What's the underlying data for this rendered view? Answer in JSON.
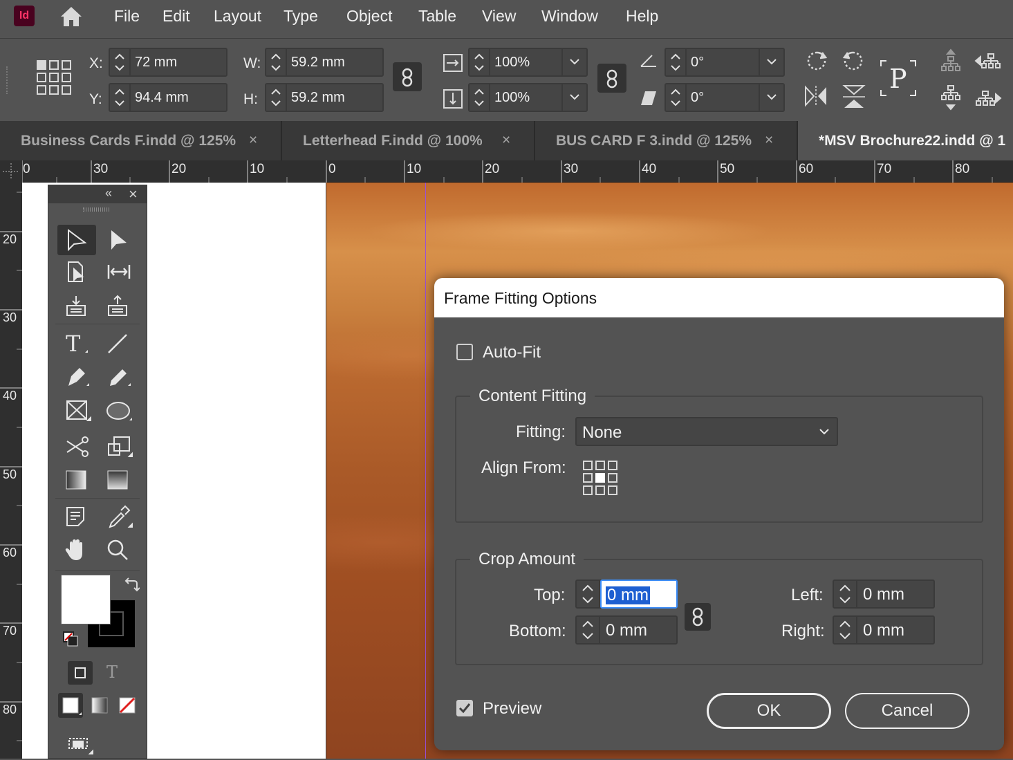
{
  "menu": {
    "app_logo": "Id",
    "items": [
      "File",
      "Edit",
      "Layout",
      "Type",
      "Object",
      "Table",
      "View",
      "Window",
      "Help"
    ]
  },
  "control": {
    "x_label": "X:",
    "x_value": "72 mm",
    "y_label": "Y:",
    "y_value": "94.4 mm",
    "w_label": "W:",
    "w_value": "59.2 mm",
    "h_label": "H:",
    "h_value": "59.2 mm",
    "scale_x": "100%",
    "scale_y": "100%",
    "rotate": "0°",
    "shear": "0°",
    "p_glyph": "P"
  },
  "tabs": [
    {
      "label": "Business Cards F.indd @ 125%",
      "close": "×"
    },
    {
      "label": "Letterhead F.indd @ 100%",
      "close": "×"
    },
    {
      "label": "BUS CARD F 3.indd @ 125%",
      "close": "×"
    },
    {
      "label": "*MSV Brochure22.indd @ 1"
    }
  ],
  "ruler": {
    "h_numbers": [
      "0",
      "30",
      "20",
      "10",
      "0",
      "10",
      "20",
      "30",
      "40",
      "50",
      "60",
      "70",
      "80"
    ],
    "v_numbers": [
      "20",
      "30",
      "40",
      "50",
      "60",
      "70",
      "80"
    ]
  },
  "dialog": {
    "title": "Frame Fitting Options",
    "autofit_label": "Auto-Fit",
    "autofit_checked": false,
    "content_fitting_title": "Content Fitting",
    "fitting_label": "Fitting:",
    "fitting_value": "None",
    "align_from_label": "Align From:",
    "crop_amount_title": "Crop Amount",
    "top_label": "Top:",
    "top_value": "0 mm",
    "bottom_label": "Bottom:",
    "bottom_value": "0 mm",
    "left_label": "Left:",
    "left_value": "0 mm",
    "right_label": "Right:",
    "right_value": "0 mm",
    "preview_label": "Preview",
    "preview_checked": true,
    "ok_label": "OK",
    "cancel_label": "Cancel"
  },
  "tools_panel": {
    "collapse_glyph": "«",
    "close_glyph": "×",
    "text_glyph": "T"
  },
  "colors": {
    "ui_bg": "#535353",
    "tab_bg": "#383838",
    "focus_blue": "#3b8cf7",
    "guide_purple": "#9b4fd6",
    "logo_bg": "#49021f",
    "logo_fg": "#ff3366"
  }
}
